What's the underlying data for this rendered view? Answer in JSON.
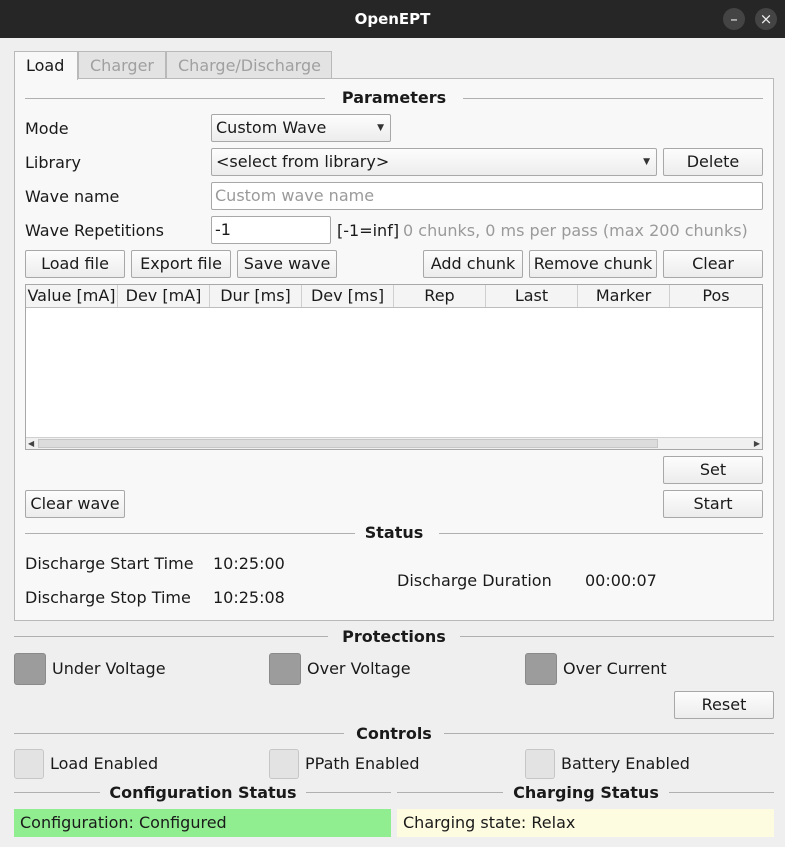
{
  "window": {
    "title": "OpenEPT",
    "minimize_glyph": "–",
    "close_glyph": "×"
  },
  "tabs": [
    {
      "label": "Load",
      "active": true
    },
    {
      "label": "Charger",
      "active": false
    },
    {
      "label": "Charge/Discharge",
      "active": false
    }
  ],
  "parameters": {
    "title": "Parameters",
    "mode_label": "Mode",
    "mode_value": "Custom Wave",
    "library_label": "Library",
    "library_value": "<select from library>",
    "delete_label": "Delete",
    "wave_name_label": "Wave name",
    "wave_name_value": "",
    "wave_name_placeholder": "Custom wave name",
    "wave_reps_label": "Wave Repetitions",
    "wave_reps_value": "-1",
    "wave_reps_hint": "[-1=inf]",
    "wave_info": "0 chunks, 0 ms per pass (max 200 chunks)",
    "load_file": "Load file",
    "export_file": "Export file",
    "save_wave": "Save wave",
    "add_chunk": "Add chunk",
    "remove_chunk": "Remove chunk",
    "clear": "Clear",
    "table_columns": [
      "Value [mA]",
      "Dev [mA]",
      "Dur [ms]",
      "Dev [ms]",
      "Rep",
      "Last",
      "Marker",
      "Pos"
    ],
    "set": "Set",
    "start": "Start",
    "clear_wave": "Clear wave"
  },
  "status": {
    "title": "Status",
    "start_time_label": "Discharge Start Time",
    "start_time_value": "10:25:00",
    "stop_time_label": "Discharge Stop Time",
    "stop_time_value": "10:25:08",
    "duration_label": "Discharge Duration",
    "duration_value": "00:00:07"
  },
  "protections": {
    "title": "Protections",
    "under_voltage": "Under Voltage",
    "over_voltage": "Over Voltage",
    "over_current": "Over Current",
    "reset": "Reset"
  },
  "controls": {
    "title": "Controls",
    "load_enabled": "Load Enabled",
    "ppath_enabled": "PPath Enabled",
    "battery_enabled": "Battery Enabled"
  },
  "configuration": {
    "title": "Configuration Status",
    "value": "Configuration: Configured",
    "color": "#90ee90"
  },
  "charging": {
    "title": "Charging Status",
    "value": "Charging state: Relax",
    "color": "#fdfbe0"
  }
}
